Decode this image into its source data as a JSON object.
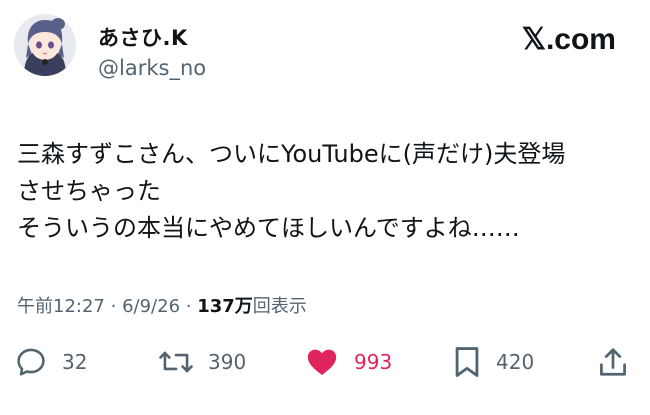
{
  "author": {
    "display_name": "あさひ.K",
    "handle": "@larks_no",
    "avatar_icon": "anime-avatar-icon"
  },
  "brand": {
    "label": "𝕏.com"
  },
  "tweet": {
    "lines": [
      "三森すずこさん、ついにYouTubeに(声だけ)夫登場",
      "させちゃった",
      "そういうの本当にやめてほしいんですよね……"
    ]
  },
  "meta": {
    "time": "午前12:27",
    "separator": "·",
    "date": "6/9/26",
    "views_count": "137万",
    "views_label": "回表示"
  },
  "actions": {
    "reply": {
      "icon": "reply-icon",
      "count": "32"
    },
    "retweet": {
      "icon": "retweet-icon",
      "count": "390"
    },
    "like": {
      "icon": "heart-icon",
      "count": "993",
      "color": "#e0245e"
    },
    "bookmark": {
      "icon": "bookmark-icon",
      "count": "420"
    },
    "share": {
      "icon": "share-icon"
    }
  },
  "colors": {
    "text": "#0f1419",
    "secondary": "#536471",
    "like": "#e0245e"
  }
}
